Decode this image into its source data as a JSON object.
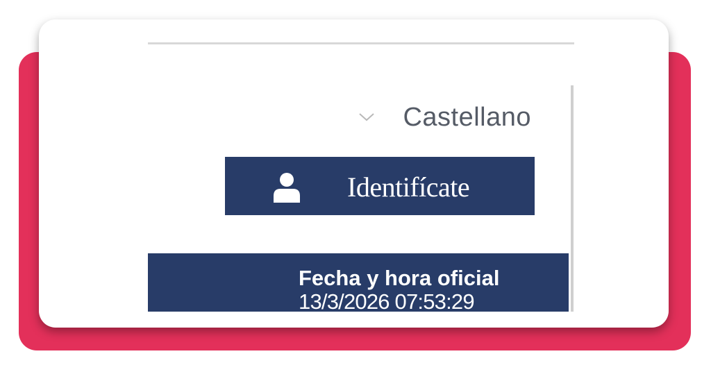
{
  "colors": {
    "accent": "#e3305a",
    "navy": "#283c68",
    "text_gray": "#555b66"
  },
  "header": {
    "language": {
      "selected": "Castellano",
      "icon": "chevron-down-icon"
    },
    "login": {
      "label": "Identifícate",
      "icon": "user-icon"
    }
  },
  "clock": {
    "title": "Fecha y hora oficial",
    "value": "13/3/2026 07:53:29"
  }
}
